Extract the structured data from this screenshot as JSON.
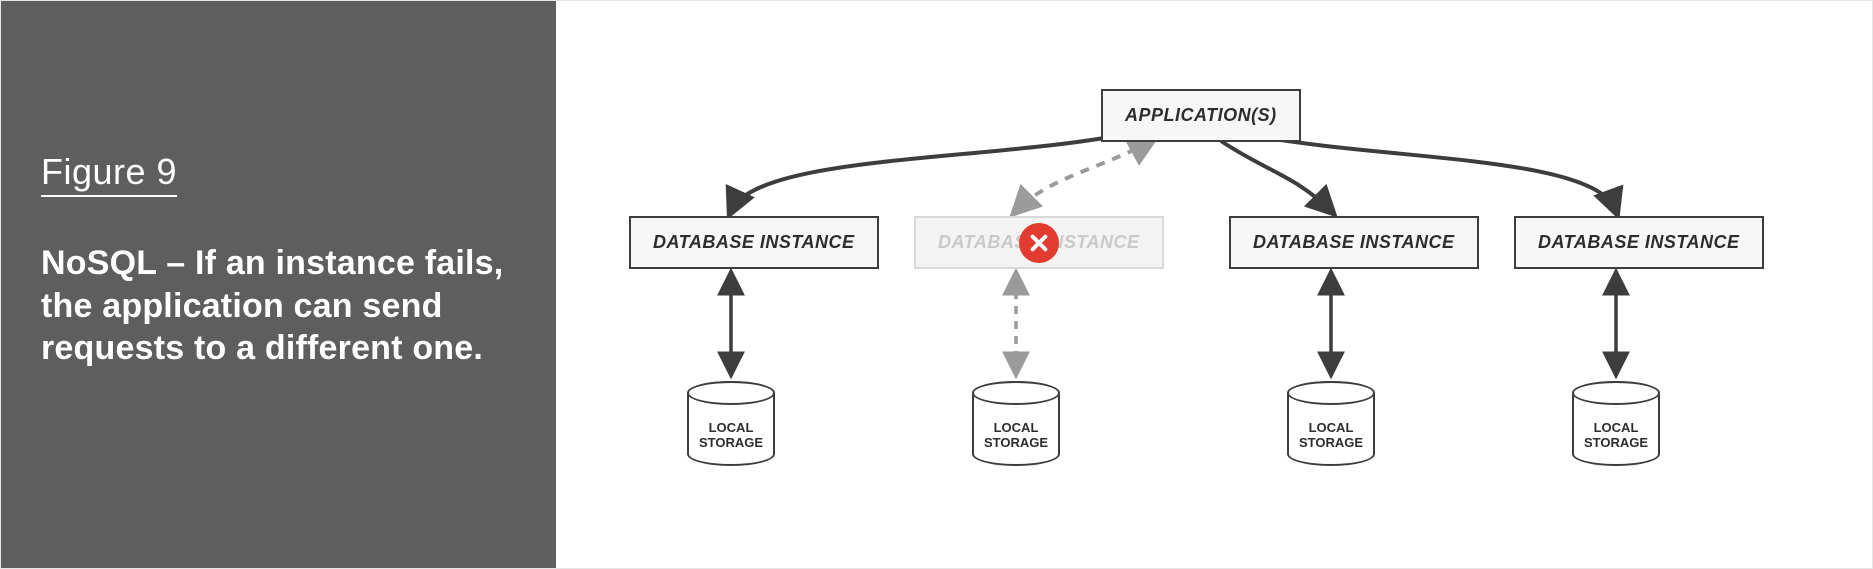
{
  "figure": {
    "label": "Figure 9",
    "caption": "NoSQL – If an instance fails, the application can send requests to a different one."
  },
  "diagram": {
    "top_node": "APPLICATION(S)",
    "instances": [
      {
        "label": "DATABASE INSTANCE",
        "failed": false
      },
      {
        "label": "DATABASE INSTANCE",
        "failed": true
      },
      {
        "label": "DATABASE INSTANCE",
        "failed": false
      },
      {
        "label": "DATABASE INSTANCE",
        "failed": false
      }
    ],
    "storage_label_line1": "LOCAL",
    "storage_label_line2": "STORAGE"
  }
}
